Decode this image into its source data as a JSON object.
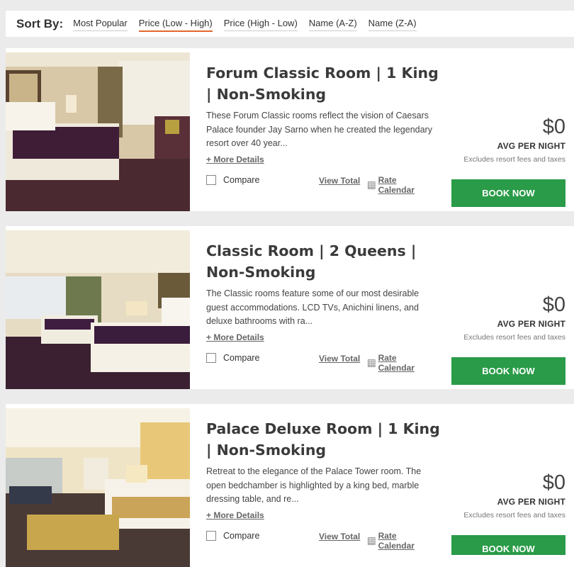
{
  "sort": {
    "label": "Sort By:",
    "options": [
      "Most Popular",
      "Price (Low - High)",
      "Price (High - Low)",
      "Name (A-Z)",
      "Name (Z-A)"
    ],
    "active_index": 1
  },
  "rooms": [
    {
      "title": "Forum Classic Room | 1 King | Non-Smoking",
      "description": "These Forum Classic rooms reflect the vision of Caesars Palace founder Jay Sarno when he created the legendary resort over 40 year...",
      "more_details": "+ More Details",
      "compare": "Compare",
      "view_total": "View Total",
      "rate_calendar": "Rate Calendar",
      "price": "$0",
      "per_night": "AVG PER NIGHT",
      "excludes": "Excludes resort fees and taxes",
      "book_now": "BOOK NOW"
    },
    {
      "title": "Classic Room | 2 Queens | Non-Smoking",
      "description": "The Classic rooms feature some of our most desirable guest accommodations. LCD TVs, Anichini linens, and deluxe bathrooms with ra...",
      "more_details": "+ More Details",
      "compare": "Compare",
      "view_total": "View Total",
      "rate_calendar": "Rate Calendar",
      "price": "$0",
      "per_night": "AVG PER NIGHT",
      "excludes": "Excludes resort fees and taxes",
      "book_now": "BOOK NOW"
    },
    {
      "title": "Palace Deluxe Room | 1 King | Non-Smoking",
      "description": "Retreat to the elegance of the Palace Tower room. The open bedchamber is highlighted by a king bed, marble dressing table, and re...",
      "more_details": "+ More Details",
      "compare": "Compare",
      "view_total": "View Total",
      "rate_calendar": "Rate Calendar",
      "price": "$0",
      "per_night": "AVG PER NIGHT",
      "excludes": "Excludes resort fees and taxes",
      "book_now": "BOOK NOW"
    }
  ],
  "colors": {
    "book_button": "#2a9b48",
    "active_sort_underline": "#e2672f"
  },
  "icons": {
    "rate_calendar": "calendar-icon"
  }
}
